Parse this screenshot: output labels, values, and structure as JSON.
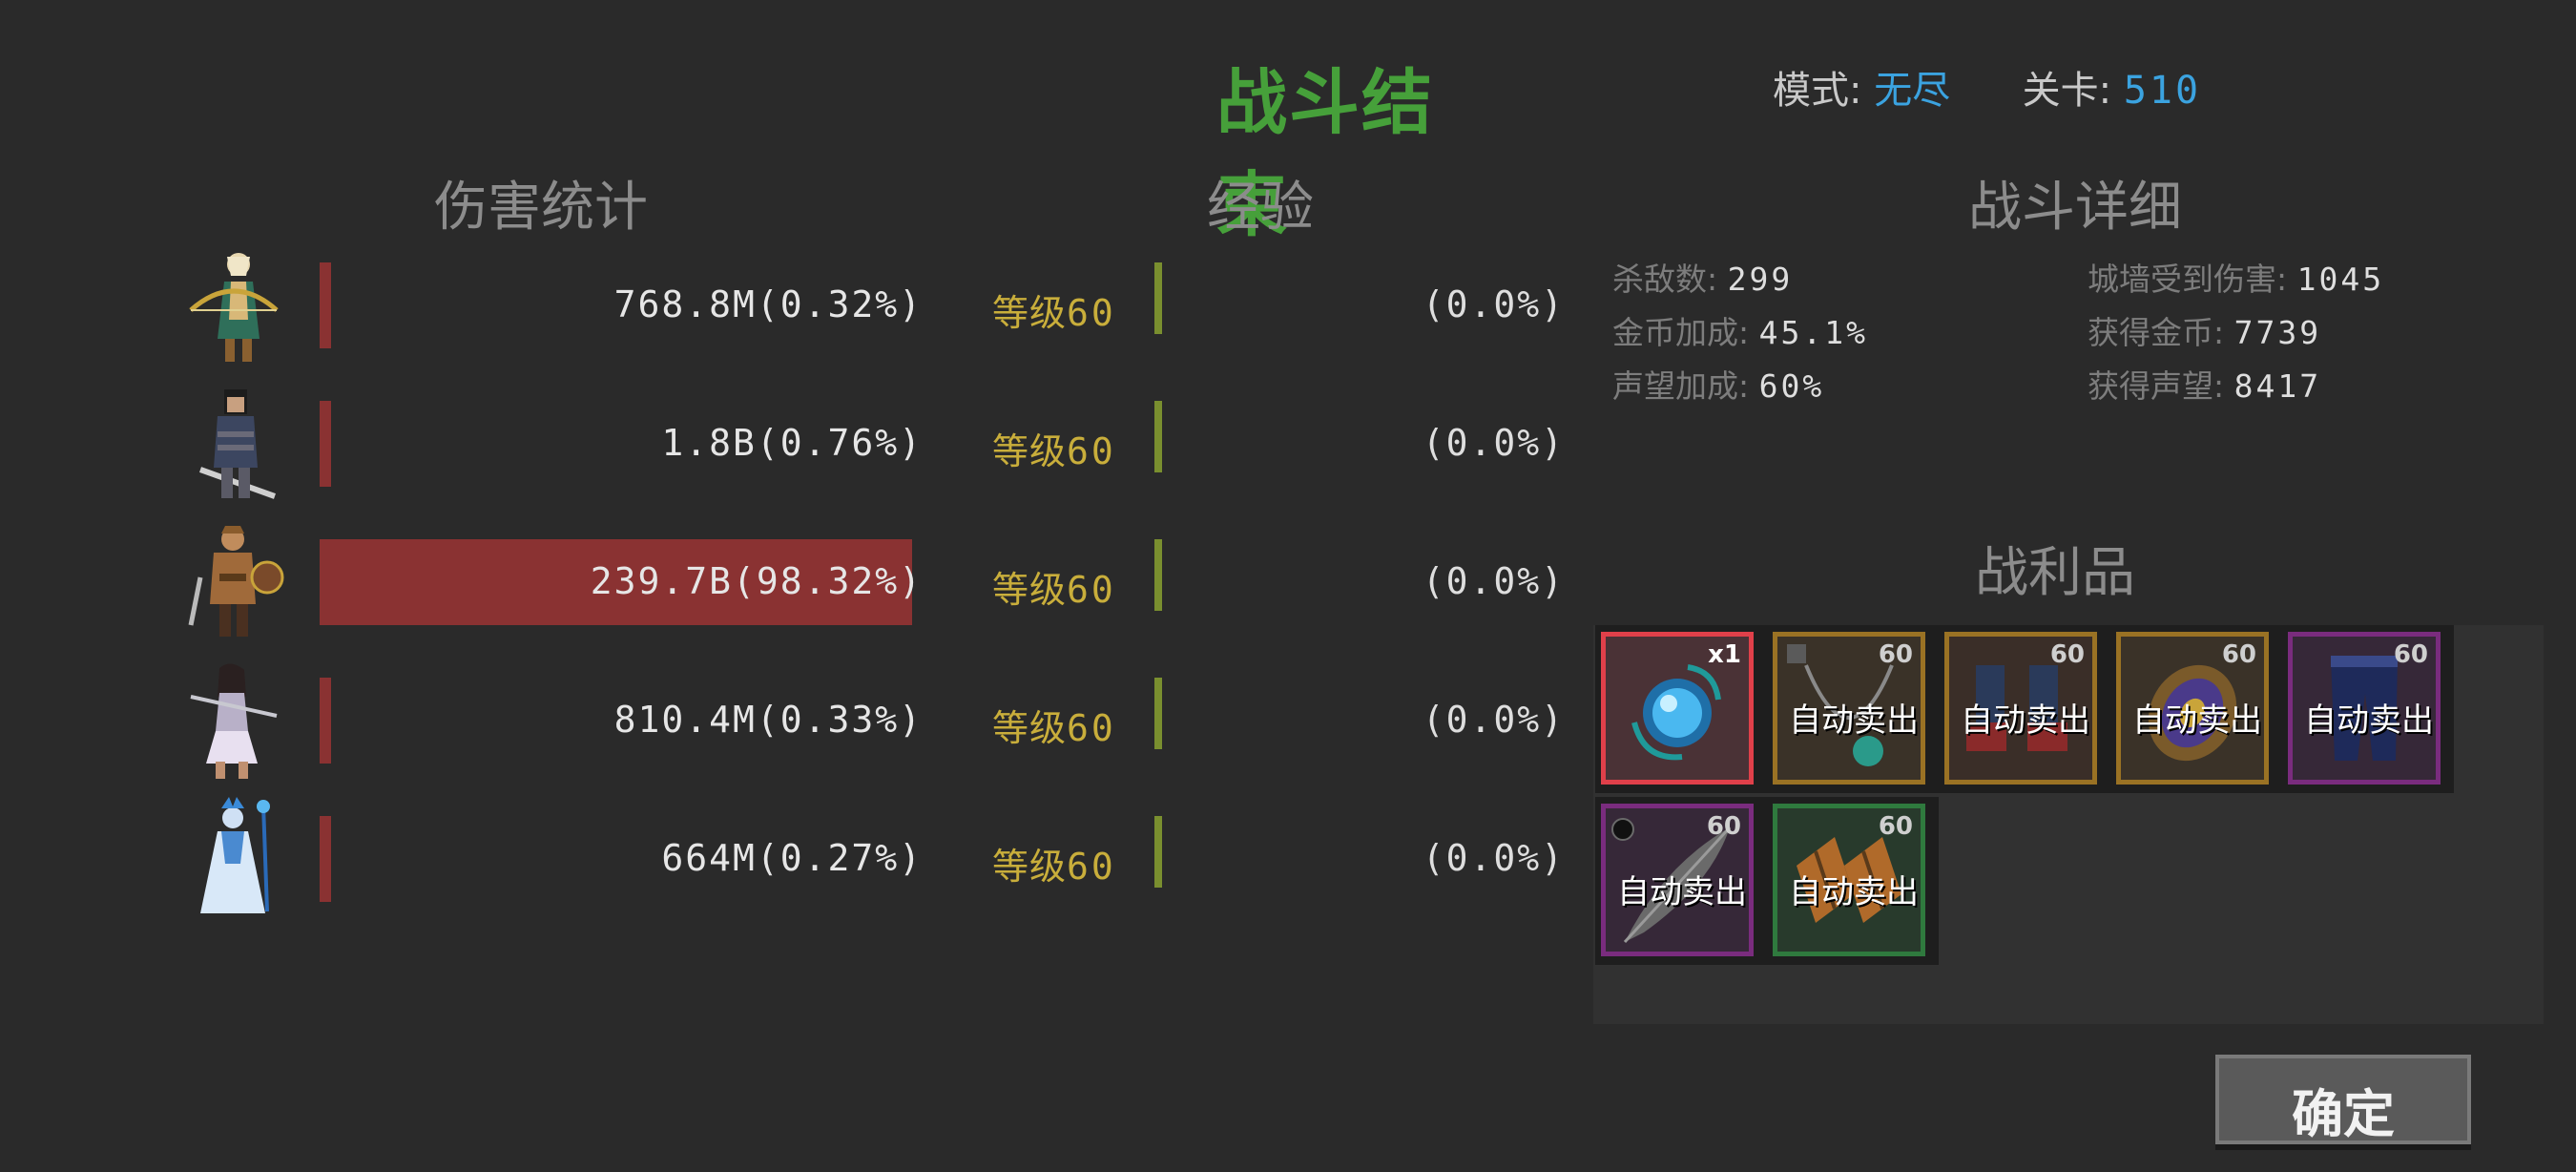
{
  "header": {
    "title": "战斗结束",
    "mode_label": "模式:",
    "mode_value": "无尽",
    "level_label": "关卡:",
    "level_value": "510"
  },
  "sections": {
    "damage": "伤害统计",
    "experience": "经验",
    "details": "战斗详细",
    "loot": "战利品"
  },
  "heroes": [
    {
      "portrait": "elf-archer-icon",
      "damage": "768.8M(0.32%)",
      "share": 0.32,
      "level_label": "等级",
      "level": "60",
      "exp": "(0.0%)"
    },
    {
      "portrait": "knight-swordsman-icon",
      "damage": "1.8B(0.76%)",
      "share": 0.76,
      "level_label": "等级",
      "level": "60",
      "exp": "(0.0%)"
    },
    {
      "portrait": "barbarian-warrior-icon",
      "damage": "239.7B(98.32%)",
      "share": 98.32,
      "level_label": "等级",
      "level": "60",
      "exp": "(0.0%)"
    },
    {
      "portrait": "amazon-spearwoman-icon",
      "damage": "810.4M(0.33%)",
      "share": 0.33,
      "level_label": "等级",
      "level": "60",
      "exp": "(0.0%)"
    },
    {
      "portrait": "ice-sorceress-icon",
      "damage": "664M(0.27%)",
      "share": 0.27,
      "level_label": "等级",
      "level": "60",
      "exp": "(0.0%)"
    }
  ],
  "details": {
    "kills_label": "杀敌数:",
    "kills": "299",
    "wall_damage_label": "城墙受到伤害:",
    "wall_damage": "1045",
    "gold_bonus_label": "金币加成:",
    "gold_bonus": "45.1%",
    "gold_gained_label": "获得金币:",
    "gold_gained": "7739",
    "prestige_bonus_label": "声望加成:",
    "prestige_bonus": "60%",
    "prestige_gained_label": "获得声望:",
    "prestige_gained": "8417"
  },
  "loot": [
    {
      "icon": "blue-orb-icon",
      "badge": "x1",
      "rarity_color": "#e0404a",
      "sell": ""
    },
    {
      "icon": "amulet-icon",
      "badge": "60",
      "rarity_color": "#9a7224",
      "sell": "自动卖出"
    },
    {
      "icon": "boots-icon",
      "badge": "60",
      "rarity_color": "#9a7224",
      "sell": "自动卖出"
    },
    {
      "icon": "shield-icon",
      "badge": "60",
      "rarity_color": "#9a7224",
      "sell": "自动卖出"
    },
    {
      "icon": "leggings-icon",
      "badge": "60",
      "rarity_color": "#7a2c7e",
      "sell": "自动卖出"
    },
    {
      "icon": "feather-icon",
      "badge": "60",
      "rarity_color": "#7a2c7e",
      "sell": "自动卖出"
    },
    {
      "icon": "bracers-icon",
      "badge": "60",
      "rarity_color": "#2f7a3e",
      "sell": "自动卖出"
    }
  ],
  "confirm_label": "确定",
  "colors": {
    "title": "#46a03a",
    "mode_value": "#3ba3e0",
    "level_text": "#c9ae3b",
    "damage_bar": "#8a3232",
    "exp_bar": "#7a8f2f"
  }
}
